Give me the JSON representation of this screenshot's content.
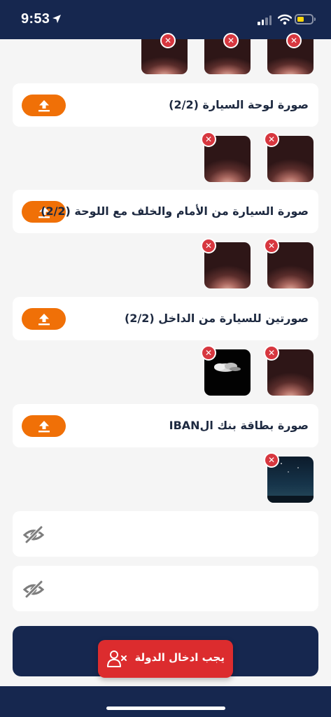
{
  "status": {
    "time": "9:53"
  },
  "sections": [
    {
      "title": "صورة لوحة السيارة (2/2)"
    },
    {
      "title": "صورة السيارة من الأمام والخلف مع اللوحة (2/2)"
    },
    {
      "title": "صورتين للسيارة من الداخل (2/2)"
    },
    {
      "title": "صورة بطاقة بنك الIBAN"
    }
  ],
  "icons": {
    "upload": "upload-icon",
    "remove": "close-icon",
    "password_toggle": "eye-slash-icon",
    "toast": "user-remove-icon"
  },
  "toast": {
    "message": "يجب ادخال الدولة"
  },
  "colors": {
    "header": "#16274f",
    "accent": "#f07007",
    "error": "#dc2c2e",
    "remove": "#d7373f",
    "background": "#f5f5f5"
  }
}
